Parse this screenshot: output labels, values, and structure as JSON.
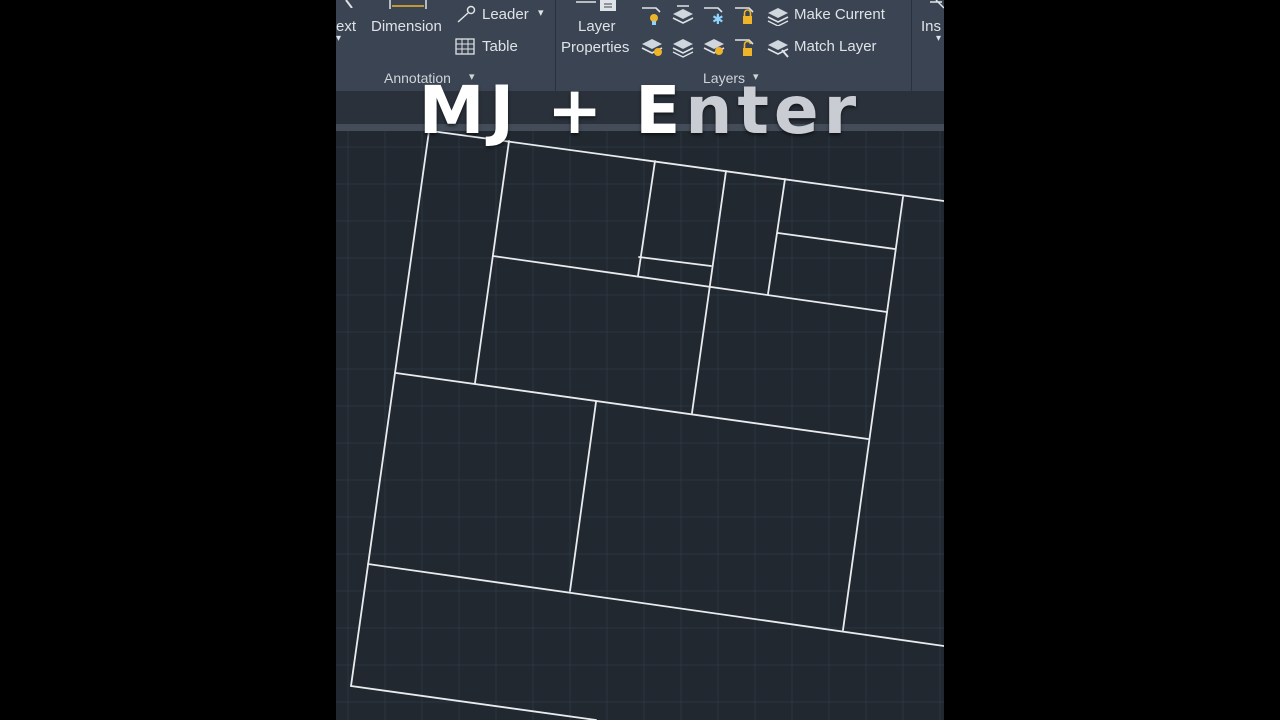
{
  "ribbon": {
    "text_partial": "ext",
    "dimension_label": "Dimension",
    "leader_label": "Leader",
    "table_label": "Table",
    "annotation_panel_label": "Annotation",
    "layer_properties_line1": "Layer",
    "layer_properties_line2": "Properties",
    "make_current_label": "Make Current",
    "match_layer_label": "Match Layer",
    "layers_panel_label": "Layers",
    "insert_partial": "Ins",
    "dropdown_glyph": "▾"
  },
  "overlay": {
    "bright": "MJ + E",
    "faded": "nter"
  },
  "colors": {
    "ribbon_bg": "#3b4453",
    "canvas_bg": "#212830",
    "grid_line": "#2c3541",
    "geometry": "#e9ecef",
    "icon_accent": "#f0b429"
  }
}
